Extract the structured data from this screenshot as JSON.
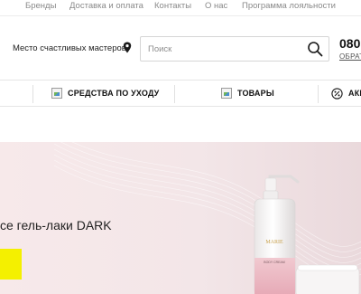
{
  "top_links": [
    "Бренды",
    "Доставка и оплата",
    "Контакты",
    "О нас",
    "Программа лояльности"
  ],
  "header": {
    "city": "Место счастливых мастеров",
    "search_placeholder": "Поиск",
    "phone": "080",
    "callback": "ОБРАТ"
  },
  "nav": {
    "items": [
      {
        "label": "СРЕДСТВА ПО УХОДУ",
        "icon": "broken-image-icon"
      },
      {
        "label": "ТОВАРЫ",
        "icon": "broken-image-icon"
      },
      {
        "label": "АКЦ",
        "icon": "percent-badge-icon"
      }
    ]
  },
  "hero": {
    "text": "се гель-лаки DARK",
    "product_label": "MARIE",
    "product_sub": "BODY CREAM"
  },
  "colors": {
    "accent_button": "#f4f000",
    "hero_bg": "#f3e6e8",
    "border": "#e5e5e5"
  }
}
